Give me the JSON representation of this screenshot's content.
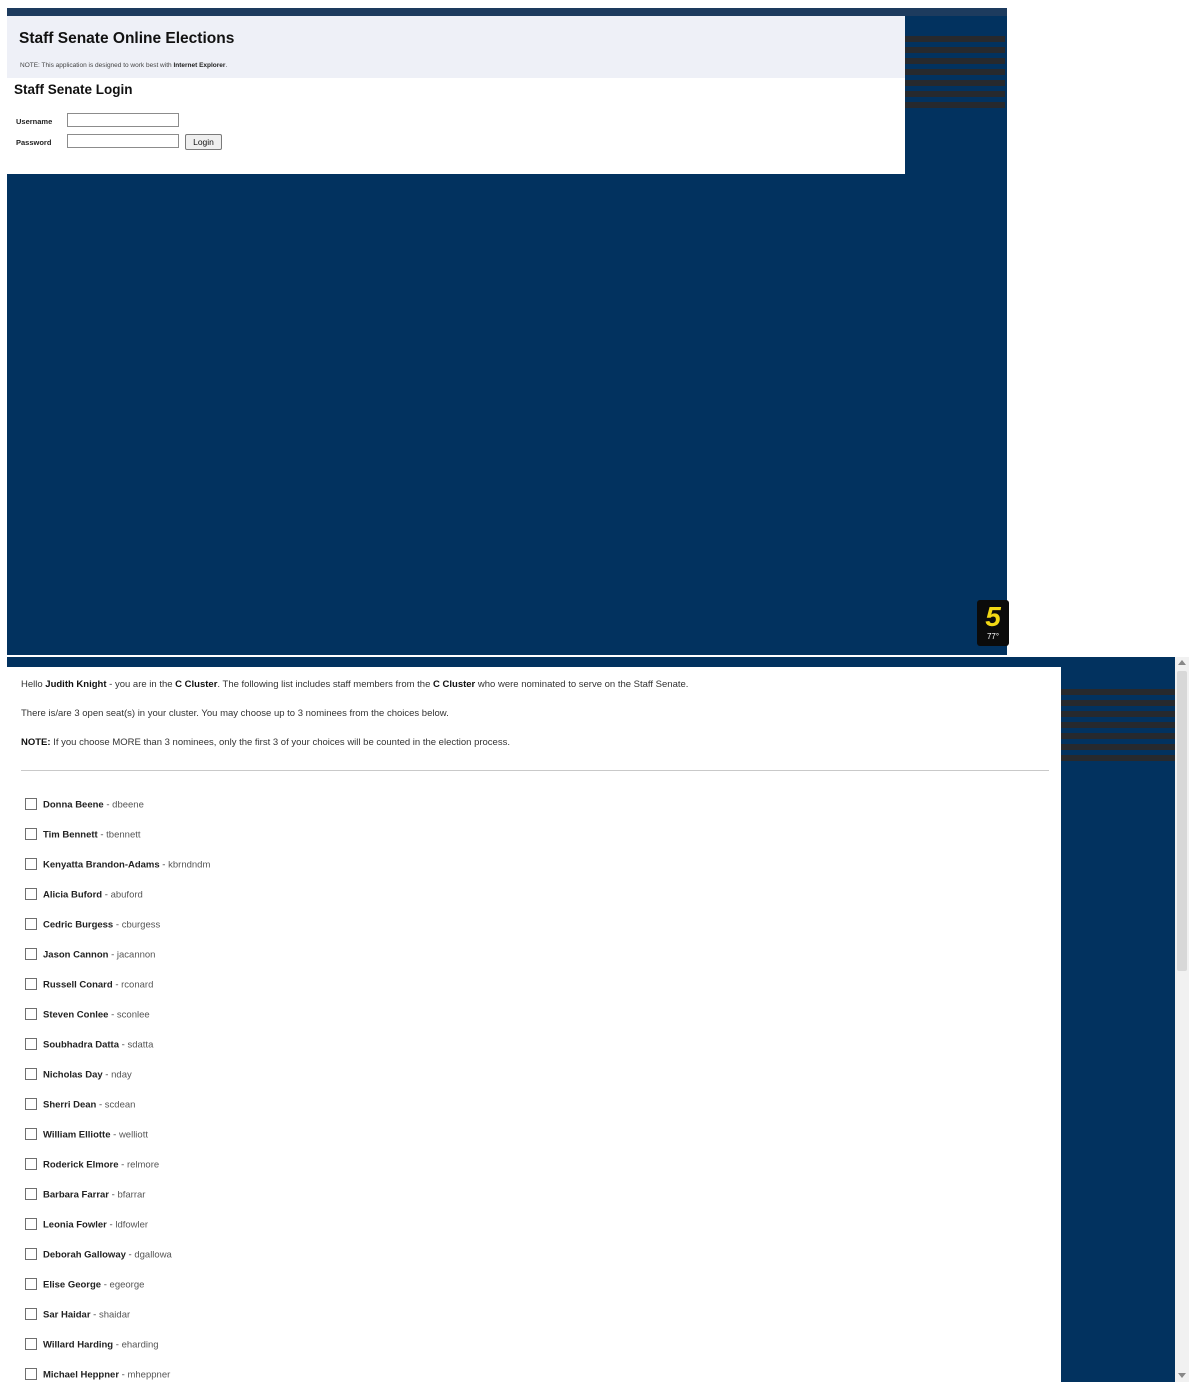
{
  "login_screen": {
    "app_title": "Staff Senate Online Elections",
    "note_prefix": "NOTE: This application is designed to work best with",
    "note_browser": "Internet Explorer",
    "note_suffix": ".",
    "login_heading": "Staff Senate Login",
    "username_label": "Username",
    "password_label": "Password",
    "username_value": "",
    "password_value": "",
    "login_button": "Login",
    "badge_glyph": "5",
    "badge_temperature": "77°"
  },
  "ballot_screen": {
    "greeting": "Hello",
    "user_name": "Judith Knight",
    "cluster_text_1": "- you are in the",
    "cluster_name": "C Cluster",
    "cluster_text_2": ". The following list includes staff members from the",
    "cluster_name_2": "C Cluster",
    "cluster_text_3": "who were nominated to serve on the Staff Senate.",
    "seats_text": "There is/are 3 open seat(s) in your cluster. You may choose up to 3 nominees from the choices below.",
    "note_label": "NOTE:",
    "note_text": "If you choose MORE than 3 nominees, only the first 3 of your choices will be counted in the election process.",
    "separator": " - ",
    "nominees": [
      {
        "name": "Donna Beene",
        "username": "dbeene"
      },
      {
        "name": "Tim Bennett",
        "username": "tbennett"
      },
      {
        "name": "Kenyatta Brandon-Adams",
        "username": "kbrndndm"
      },
      {
        "name": "Alicia Buford",
        "username": "abuford"
      },
      {
        "name": "Cedric Burgess",
        "username": "cburgess"
      },
      {
        "name": "Jason Cannon",
        "username": "jacannon"
      },
      {
        "name": "Russell Conard",
        "username": "rconard"
      },
      {
        "name": "Steven Conlee",
        "username": "sconlee"
      },
      {
        "name": "Soubhadra Datta",
        "username": "sdatta"
      },
      {
        "name": "Nicholas Day",
        "username": "nday"
      },
      {
        "name": "Sherri Dean",
        "username": "scdean"
      },
      {
        "name": "William Elliotte",
        "username": "welliott"
      },
      {
        "name": "Roderick Elmore",
        "username": "relmore"
      },
      {
        "name": "Barbara Farrar",
        "username": "bfarrar"
      },
      {
        "name": "Leonia Fowler",
        "username": "ldfowler"
      },
      {
        "name": "Deborah Galloway",
        "username": "dgallowa"
      },
      {
        "name": "Elise George",
        "username": "egeorge"
      },
      {
        "name": "Sar Haidar",
        "username": "shaidar"
      },
      {
        "name": "Willard Harding",
        "username": "eharding"
      },
      {
        "name": "Michael Heppner",
        "username": "mheppner"
      }
    ]
  },
  "colors": {
    "page_background": "#02325f",
    "header_background": "#eef0f7",
    "stripe": "#27292d",
    "badge_digit": "#f2d814"
  }
}
